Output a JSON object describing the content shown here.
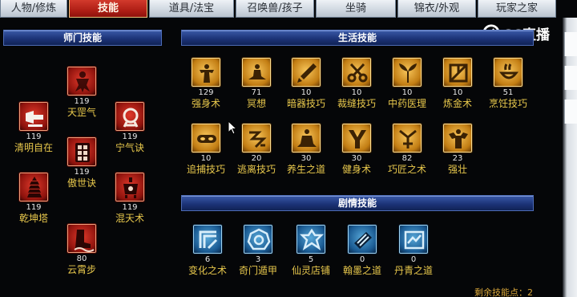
{
  "tabs": [
    {
      "label": "人物/修炼",
      "active": false
    },
    {
      "label": "技能",
      "active": true
    },
    {
      "label": "道具/法宝",
      "active": false
    },
    {
      "label": "召唤兽/孩子",
      "active": false
    },
    {
      "label": "坐骑",
      "active": false
    },
    {
      "label": "锦衣/外观",
      "active": false
    },
    {
      "label": "玩家之家",
      "active": false
    }
  ],
  "watermark": {
    "text": "CC直播"
  },
  "sections": {
    "school": {
      "title": "师门技能"
    },
    "life": {
      "title": "生活技能"
    },
    "story": {
      "title": "剧情技能"
    }
  },
  "school_skills": [
    {
      "name": "天罡气",
      "level": "119",
      "color": "red",
      "icon": "warrior-icon"
    },
    {
      "name": "清明自在",
      "level": "119",
      "color": "red",
      "icon": "horn-icon"
    },
    {
      "name": "宁气诀",
      "level": "119",
      "color": "red",
      "icon": "ring-icon"
    },
    {
      "name": "傲世诀",
      "level": "119",
      "color": "red",
      "icon": "gate-icon"
    },
    {
      "name": "乾坤塔",
      "level": "119",
      "color": "red",
      "icon": "pagoda-icon"
    },
    {
      "name": "混天术",
      "level": "119",
      "color": "red",
      "icon": "cauldron-icon"
    },
    {
      "name": "云霄步",
      "level": "80",
      "color": "red",
      "icon": "boot-icon"
    }
  ],
  "life_skills": [
    {
      "name": "强身术",
      "level": "129",
      "color": "gold",
      "icon": "strength-icon"
    },
    {
      "name": "冥想",
      "level": "71",
      "color": "gold",
      "icon": "meditate-icon"
    },
    {
      "name": "暗器技巧",
      "level": "10",
      "color": "gold",
      "icon": "dart-icon"
    },
    {
      "name": "裁缝技巧",
      "level": "10",
      "color": "gold",
      "icon": "scissors-icon"
    },
    {
      "name": "中药医理",
      "level": "10",
      "color": "gold",
      "icon": "herb-icon"
    },
    {
      "name": "炼金术",
      "level": "10",
      "color": "gold",
      "icon": "alchemy-icon"
    },
    {
      "name": "烹饪技巧",
      "level": "51",
      "color": "gold",
      "icon": "cooking-icon"
    },
    {
      "name": "追捕技巧",
      "level": "10",
      "color": "gold",
      "icon": "mask-icon"
    },
    {
      "name": "逃离技巧",
      "level": "20",
      "color": "gold",
      "icon": "escape-icon"
    },
    {
      "name": "养生之道",
      "level": "30",
      "color": "gold",
      "icon": "lotus-icon"
    },
    {
      "name": "健身术",
      "level": "30",
      "color": "gold",
      "icon": "fitness-icon"
    },
    {
      "name": "巧匠之术",
      "level": "82",
      "color": "gold",
      "icon": "craft-icon"
    },
    {
      "name": "强壮",
      "level": "23",
      "color": "gold",
      "icon": "muscle-icon"
    }
  ],
  "story_skills": [
    {
      "name": "变化之术",
      "level": "6",
      "color": "blue",
      "icon": "transform-icon"
    },
    {
      "name": "奇门遁甲",
      "level": "3",
      "color": "blue",
      "icon": "bagua-icon"
    },
    {
      "name": "仙灵店铺",
      "level": "5",
      "color": "blue",
      "icon": "shop-icon"
    },
    {
      "name": "翰墨之道",
      "level": "0",
      "color": "blue",
      "icon": "ink-icon"
    },
    {
      "name": "丹青之道",
      "level": "0",
      "color": "blue",
      "icon": "scroll-icon"
    }
  ],
  "footer": {
    "remaining_points": "剩余技能点：2"
  }
}
